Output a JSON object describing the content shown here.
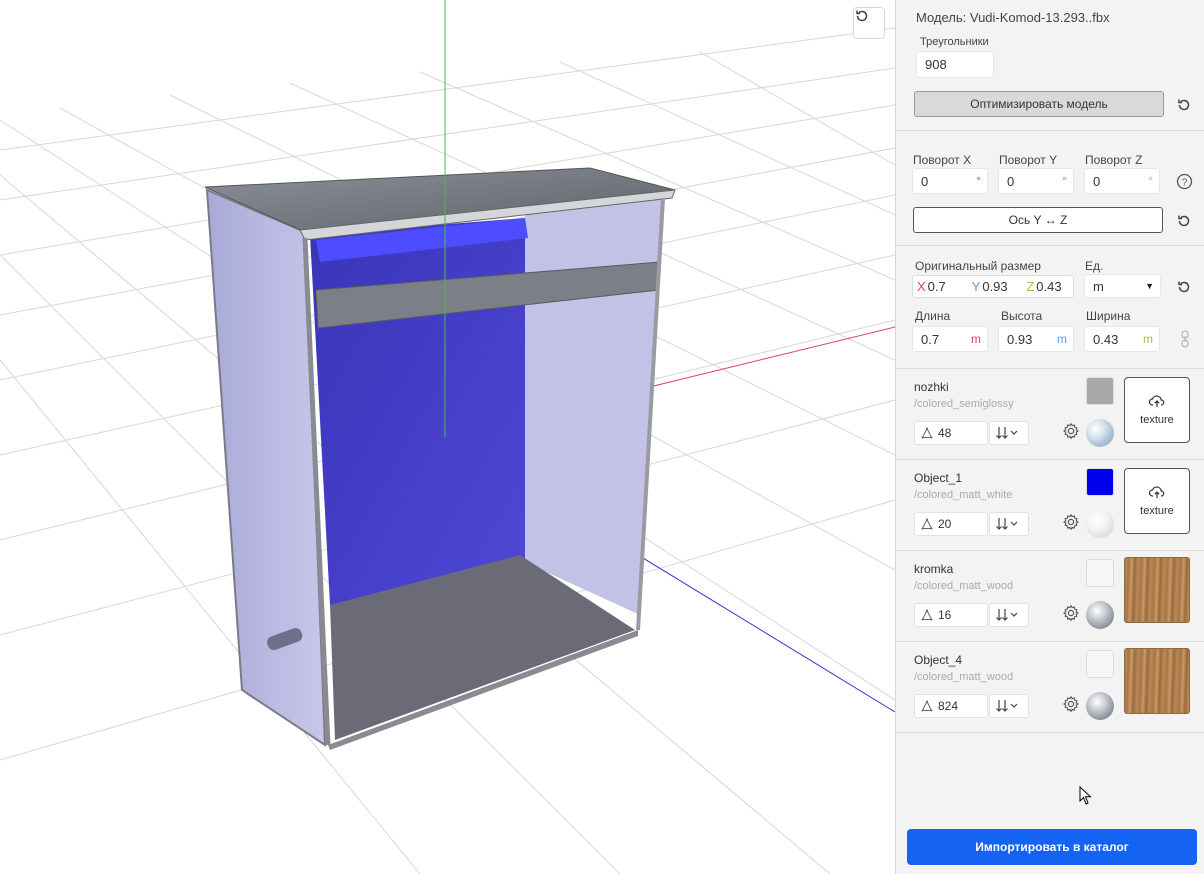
{
  "model": {
    "label": "Модель: Vudi-Komod-13.293..fbx",
    "triangles_label": "Треугольники",
    "triangles_value": "908",
    "optimize_label": "Оптимизировать модель"
  },
  "rotation": {
    "x_label": "Поворот X",
    "x_value": "0",
    "x_unit": "°",
    "y_label": "Поворот Y",
    "y_value": "0",
    "y_unit": "°",
    "z_label": "Поворот Z",
    "z_value": "0",
    "z_unit": "°",
    "swap_axes_label": "Ось Y ↔ Z"
  },
  "size": {
    "original_label": "Оригинальный размер",
    "units_label": "Ед.",
    "units_value": "m",
    "orig_x_axis": "X",
    "orig_x": "0.7",
    "orig_y_axis": "Y",
    "orig_y": "0.93",
    "orig_z_axis": "Z",
    "orig_z": "0.43",
    "length_label": "Длина",
    "length_value": "0.7",
    "length_unit": "m",
    "height_label": "Высота",
    "height_value": "0.93",
    "height_unit": "m",
    "width_label": "Ширина",
    "width_value": "0.43",
    "width_unit": "m"
  },
  "materials": [
    {
      "name": "nozhki",
      "path": "/colored_semiglossy",
      "triangles": "48",
      "color": "#a8a8a8",
      "texture": "upload",
      "texture_label": "texture"
    },
    {
      "name": "Object_1",
      "path": "/colored_matt_white",
      "triangles": "20",
      "color": "#0000ee",
      "texture": "upload",
      "texture_label": "texture"
    },
    {
      "name": "kromka",
      "path": "/colored_matt_wood",
      "triangles": "16",
      "color": "#f7f7f7",
      "texture": "wood"
    },
    {
      "name": "Object_4",
      "path": "/colored_matt_wood",
      "triangles": "824",
      "color": "#f7f7f7",
      "texture": "wood"
    }
  ],
  "import_label": "Импортировать в каталог",
  "colors": {
    "accent": "#1463f3",
    "axis_x": "#e0405a",
    "axis_y": "#33cc33",
    "axis_z": "#3333dd"
  }
}
